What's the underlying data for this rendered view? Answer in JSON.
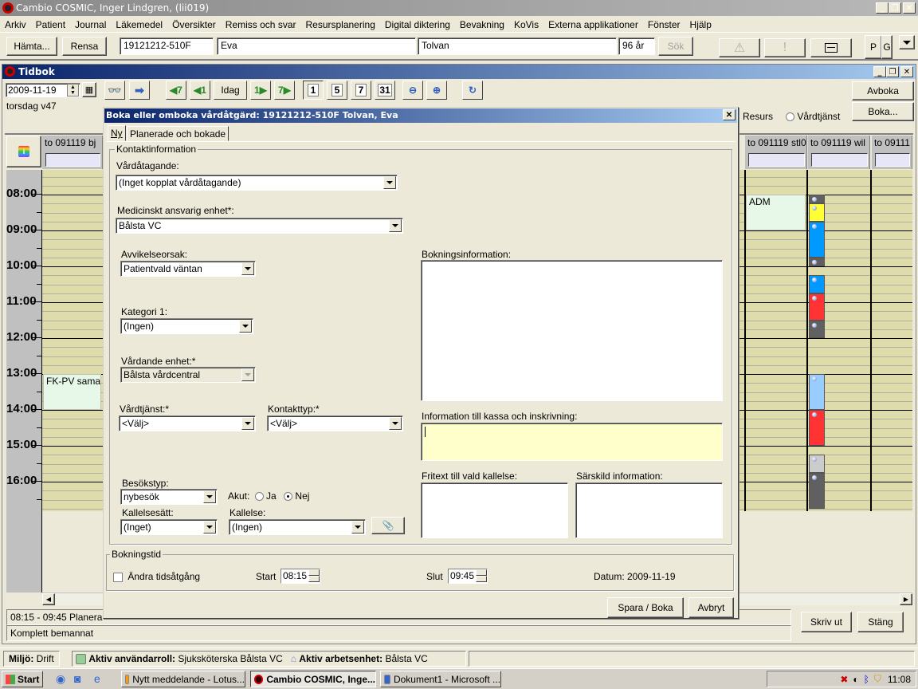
{
  "app": {
    "title": "Cambio COSMIC, Inger Lindgren, (lii019)"
  },
  "menu": [
    "Arkiv",
    "Patient",
    "Journal",
    "Läkemedel",
    "Översikter",
    "Remiss och svar",
    "Resursplanering",
    "Digital diktering",
    "Bevakning",
    "KoVis",
    "Externa applikationer",
    "Fönster",
    "Hjälp"
  ],
  "patientbar": {
    "fetch_label": "Hämta...",
    "clear_label": "Rensa",
    "personal_number": "19121212-510F",
    "first_name": "Eva",
    "last_name": "Tolvan",
    "age": "96 år",
    "search_label": "Sök",
    "warning_icon": "warning-icon",
    "alert_icon": "exclamation-icon",
    "panel_icon": "panel-icon",
    "p_label": "P",
    "g_label": "G"
  },
  "tidbok": {
    "title": "Tidbok",
    "date": "2009-11-19",
    "weekday": "torsdag v47",
    "today_label": "Idag",
    "nav_back7": "◀7",
    "nav_back1": "◀1",
    "nav_fwd1": "1▶",
    "nav_fwd7": "7▶",
    "view_1": "1",
    "view_5": "5",
    "view_7": "7",
    "view_31": "31",
    "cancel_booking_label": "Avboka",
    "book_label": "Boka...",
    "resource_radio_label": "Resurs",
    "care_service_radio_label": "Vårdtjänst",
    "hours": [
      "08:00",
      "09:00",
      "10:00",
      "11:00",
      "12:00",
      "13:00",
      "14:00",
      "15:00",
      "16:00"
    ],
    "columns": [
      {
        "header": "to 091119 bj"
      },
      {
        "header": "to 091119 stl0"
      },
      {
        "header": "to 091119 wil"
      },
      {
        "header": "to 09111"
      }
    ],
    "events": [
      {
        "column": 0,
        "label": "FK-PV samar",
        "start": "13:00",
        "end": "14:00",
        "color": "#e8f8e8"
      },
      {
        "column": 1,
        "label": "ADM",
        "start": "08:00",
        "end": "09:00",
        "color": "#e8f8e8"
      }
    ],
    "slots": [
      {
        "start": "08:00",
        "end": "08:15",
        "color": "#606060"
      },
      {
        "start": "08:15",
        "end": "08:45",
        "color": "#ffff33"
      },
      {
        "start": "08:45",
        "end": "09:45",
        "color": "#0099ff"
      },
      {
        "start": "09:45",
        "end": "10:00",
        "color": "#606060"
      },
      {
        "start": "10:15",
        "end": "10:45",
        "color": "#0099ff"
      },
      {
        "start": "10:45",
        "end": "11:30",
        "color": "#ff3333"
      },
      {
        "start": "11:30",
        "end": "12:00",
        "color": "#606060"
      },
      {
        "start": "13:00",
        "end": "14:00",
        "color": "#99ccff"
      },
      {
        "start": "14:00",
        "end": "15:00",
        "color": "#ff3333"
      },
      {
        "start": "15:15",
        "end": "15:45",
        "color": "#cccccc"
      },
      {
        "start": "15:45",
        "end": "16:45",
        "color": "#606060"
      }
    ],
    "status_time": "08:15 - 09:45  Planera",
    "status_staffing": "Komplett bemannat",
    "print_label": "Skriv ut",
    "close_label": "Stäng"
  },
  "dialog": {
    "title": "Boka eller omboka vårdåtgärd: 19121212-510F Tolvan, Eva",
    "tabs": [
      "Ny",
      "Planerade och bokade"
    ],
    "group_contact": "Kontaktinformation",
    "care_commitment_label": "Vårdåtagande:",
    "care_commitment_value": "(Inget kopplat vårdåtagande)",
    "medical_unit_label": "Medicinskt ansvarig enhet*:",
    "medical_unit_value": "Bålsta VC",
    "deviation_label": "Avvikelseorsak:",
    "deviation_value": "Patientvald väntan",
    "category_label": "Kategori 1:",
    "category_value": "(Ingen)",
    "care_unit_label": "Vårdande enhet:*",
    "care_unit_value": "Bålsta vårdcentral",
    "care_service_label": "Vårdtjänst:*",
    "care_service_value": "<Välj>",
    "contact_type_label": "Kontakttyp:*",
    "contact_type_value": "<Välj>",
    "visit_type_label": "Besökstyp:",
    "visit_type_value": "nybesök",
    "acute_label": "Akut:",
    "acute_yes": "Ja",
    "acute_no": "Nej",
    "acute_selected": "Nej",
    "summons_method_label": "Kallelsesätt:",
    "summons_method_value": "(Inget)",
    "summons_label": "Kallelse:",
    "summons_value": "(Ingen)",
    "booking_info_label": "Bokningsinformation:",
    "booking_info_value": "",
    "cashier_info_label": "Information till kassa och inskrivning:",
    "cashier_info_value": "",
    "free_text_label": "Fritext till vald kallelse:",
    "free_text_value": "",
    "special_info_label": "Särskild information:",
    "special_info_value": "",
    "group_time": "Bokningstid",
    "change_time_label": "Ändra tidsåtgång",
    "change_time_checked": false,
    "start_label": "Start",
    "start_value": "08:15",
    "end_label": "Slut",
    "end_value": "09:45",
    "date_text": "Datum: 2009-11-19",
    "save_label": "Spara / Boka",
    "cancel_label": "Avbryt"
  },
  "statusbar": {
    "env_label": "Miljö:",
    "env_value": "Drift",
    "role_label": "Aktiv användarroll:",
    "role_value": "Sjuksköterska Bålsta VC",
    "unit_label": "Aktiv arbetsenhet:",
    "unit_value": "Bålsta VC"
  },
  "taskbar": {
    "start_label": "Start",
    "tasks": [
      "Nytt meddelande - Lotus...",
      "Cambio COSMIC, Inge...",
      "Dokument1 - Microsoft ..."
    ],
    "active_task": 1,
    "clock": "11:08"
  }
}
